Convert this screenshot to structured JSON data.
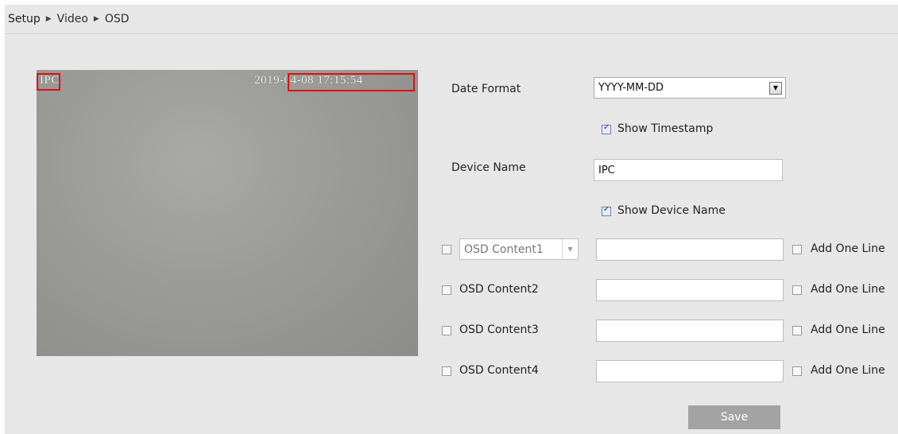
{
  "breadcrumb": {
    "items": [
      "Setup",
      "Video",
      "OSD"
    ],
    "separator": "▶"
  },
  "preview": {
    "device_name_overlay": "IPC",
    "timestamp_overlay": "2019-04-08 17:15:54"
  },
  "date_format": {
    "label": "Date Format",
    "value": "YYYY-MM-DD"
  },
  "show_timestamp": {
    "label": "Show Timestamp",
    "checked": true
  },
  "device_name": {
    "label": "Device Name",
    "value": "IPC"
  },
  "show_device_name": {
    "label": "Show Device Name",
    "checked": true
  },
  "osd_contents": [
    {
      "label": "OSD Content1",
      "enabled": false,
      "value": "",
      "add_line_label": "Add One Line",
      "add_line_checked": false
    },
    {
      "label": "OSD Content2",
      "enabled": false,
      "value": "",
      "add_line_label": "Add One Line",
      "add_line_checked": false
    },
    {
      "label": "OSD Content3",
      "enabled": false,
      "value": "",
      "add_line_label": "Add One Line",
      "add_line_checked": false
    },
    {
      "label": "OSD Content4",
      "enabled": false,
      "value": "",
      "add_line_label": "Add One Line",
      "add_line_checked": false
    }
  ],
  "save_label": "Save",
  "colors": {
    "panel_bg": "#e7e7e7",
    "osd_box": "#e01010",
    "save_button": "#a3a3a3"
  }
}
